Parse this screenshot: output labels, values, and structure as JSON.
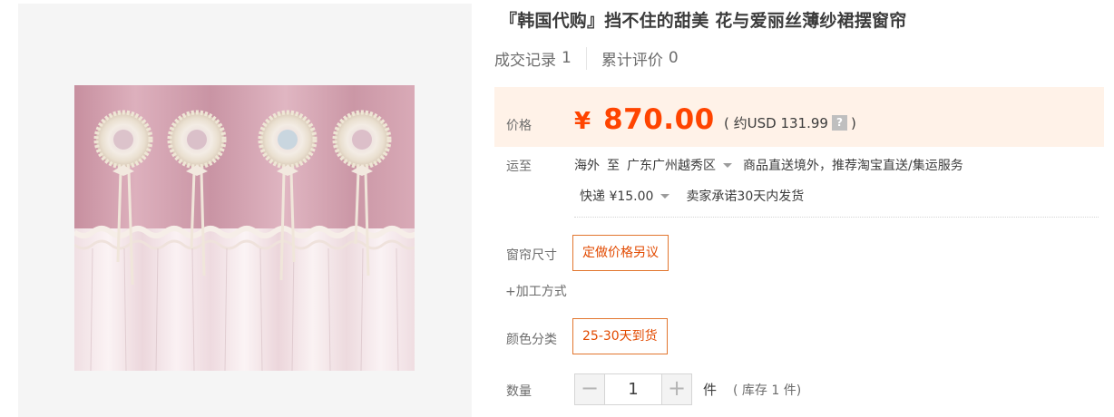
{
  "product": {
    "title": "『韩国代购』挡不住的甜美 花与爱丽丝薄纱裙摆窗帘",
    "image_alt": "pink curtain with lace flower rosettes and white tulle hem"
  },
  "stats": {
    "deals_label": "成交记录",
    "deals_count": "1",
    "reviews_label": "累计评价",
    "reviews_count": "0"
  },
  "price": {
    "label": "价格",
    "currency": "¥",
    "amount": "870.00",
    "usd_open": "( 约USD 131.99",
    "help_icon_text": "?",
    "usd_close": ")",
    "color": "#ff4400"
  },
  "shipping": {
    "label": "运至",
    "origin": "海外",
    "to": "至",
    "destination": "广东广州越秀区",
    "direct_note": "商品直送境外，推荐淘宝直送/集运服务",
    "method": "快递 ¥15.00",
    "promise": "卖家承诺30天内发货"
  },
  "sku": {
    "size_label": "窗帘尺寸",
    "size_option": "定做价格另议",
    "craft_link": "+加工方式",
    "color_label": "颜色分类",
    "color_option": "25-30天到货",
    "accent": "#e24a00"
  },
  "quantity": {
    "label": "数量",
    "minus": "−",
    "value": "1",
    "plus": "+",
    "unit": "件",
    "stock": "( 库存 1 件)"
  }
}
